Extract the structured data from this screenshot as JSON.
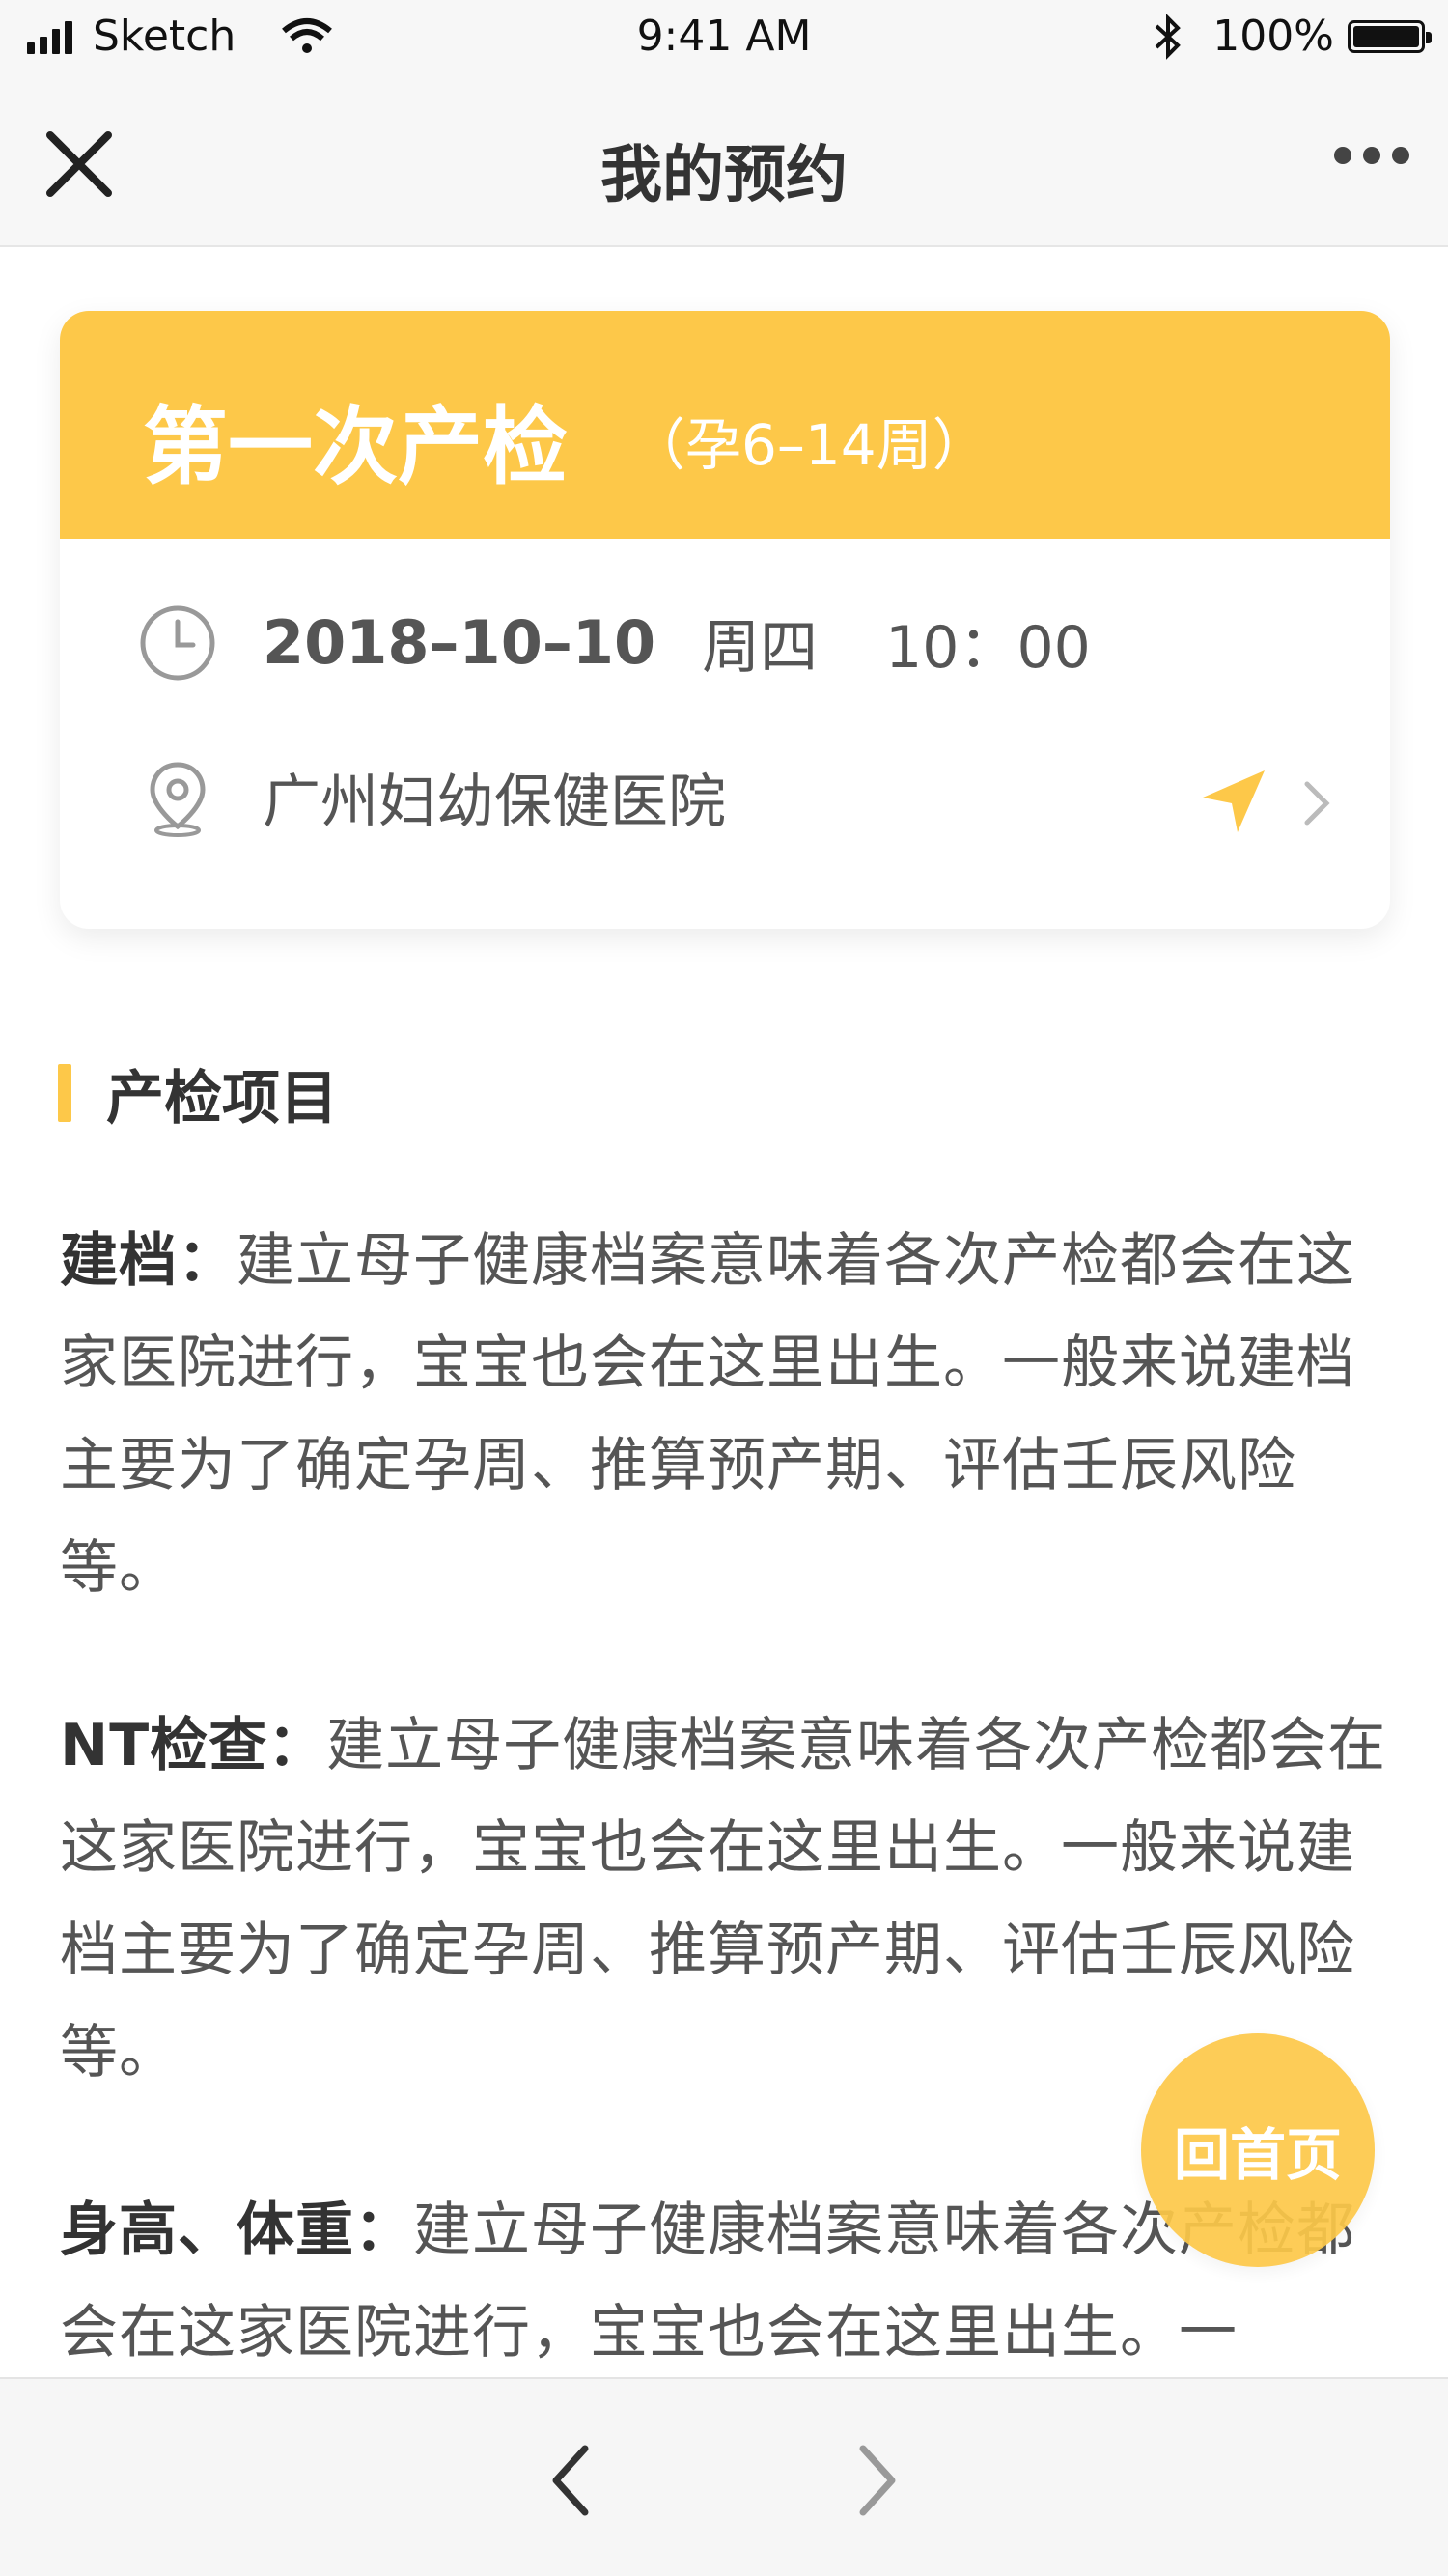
{
  "status_bar": {
    "carrier": "Sketch",
    "time": "9:41 AM",
    "battery": "100%"
  },
  "navbar": {
    "title": "我的预约",
    "close_icon": "close-icon",
    "more_icon": "more-icon"
  },
  "appointment": {
    "title": "第一次产检",
    "subtitle": "（孕6–14周）",
    "date": "2018–10–10",
    "weekday": "周四",
    "time": "10：00",
    "location": "广州妇幼保健医院",
    "accent_color": "#fdc849"
  },
  "section": {
    "title": "产检项目"
  },
  "items": [
    {
      "label": "建档：",
      "text": "建立母子健康档案意味着各次产检都会在这家医院进行，宝宝也会在这里出生。一般来说建档主要为了确定孕周、推算预产期、评估壬辰风险等。"
    },
    {
      "label": "NT检查：",
      "text": "建立母子健康档案意味着各次产检都会在这家医院进行，宝宝也会在这里出生。一般来说建档主要为了确定孕周、推算预产期、评估壬辰风险等。"
    },
    {
      "label": "身高、体重：",
      "text": "建立母子健康档案意味着各次产检都会在这家医院进行，宝宝也会在这里出生。一"
    }
  ],
  "home_button": {
    "label": "回首页"
  },
  "toolbar": {
    "prev_icon": "chevron-left-icon",
    "next_icon": "chevron-right-icon"
  }
}
